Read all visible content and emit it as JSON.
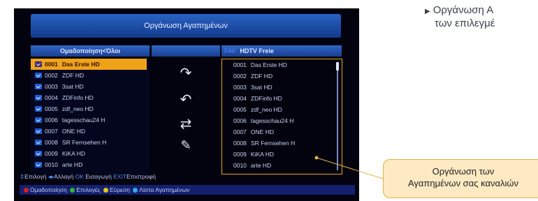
{
  "screen": {
    "title": "Οργάνωση Αγαπημένων",
    "left_header": "Ομαδοποίηση<Όλοι",
    "right_header_tag": "FAV",
    "right_header": "HDTV Freie",
    "left_channels": [
      {
        "num": "0001",
        "name": "Das Erste HD"
      },
      {
        "num": "0002",
        "name": "ZDF HD"
      },
      {
        "num": "0003",
        "name": "3sat HD"
      },
      {
        "num": "0004",
        "name": "ZDFinfo HD"
      },
      {
        "num": "0005",
        "name": "zdf_neo HD"
      },
      {
        "num": "0006",
        "name": "tagesschau24 H"
      },
      {
        "num": "0007",
        "name": "ONE HD"
      },
      {
        "num": "0008",
        "name": "SR Fernsehen H"
      },
      {
        "num": "0009",
        "name": "KiKA HD"
      },
      {
        "num": "0010",
        "name": "arte HD"
      }
    ],
    "right_channels": [
      {
        "num": "0001",
        "name": "Das Erste HD"
      },
      {
        "num": "0002",
        "name": "ZDF HD"
      },
      {
        "num": "0003",
        "name": "3sat HD"
      },
      {
        "num": "0004",
        "name": "ZDFinfo HD"
      },
      {
        "num": "0005",
        "name": "zdf_neo HD"
      },
      {
        "num": "0006",
        "name": "tagesschau24 H"
      },
      {
        "num": "0007",
        "name": "ONE HD"
      },
      {
        "num": "0008",
        "name": "SR Fernsehen H"
      },
      {
        "num": "0009",
        "name": "KiKA HD"
      },
      {
        "num": "0010",
        "name": "arte HD"
      }
    ],
    "help_line1": {
      "k1": "⇕",
      "t1": "Επιλογή",
      "k2": "◂▸",
      "t2": "Αλλαγή",
      "k3": "OK",
      "t3": "Εισαγωγή",
      "k4": "EXIT",
      "t4": "Επιστροφή"
    },
    "help_line2": {
      "t1": "Ομαδοποίηση",
      "t2": "Επιλογές",
      "t3": "Εύρεση",
      "t4": "Λίστα Αγαπημένων"
    },
    "color_keys": {
      "red": "#d42020",
      "green": "#33b533",
      "yellow": "#e8c417",
      "blue": "#3aa6e8"
    },
    "icons": [
      "redo-arrow-icon",
      "undo-arrow-icon",
      "swap-arrows-icon",
      "edit-icon"
    ]
  },
  "side_note": "Οργάνωση Α\nτων επιλεγμέ",
  "side_note_line1": "Οργάνωση Α",
  "side_note_line2": "των επιλεγμέ",
  "callout_line1": "Οργάνωση των",
  "callout_line2": "Αγαπημένων σας καναλιών"
}
